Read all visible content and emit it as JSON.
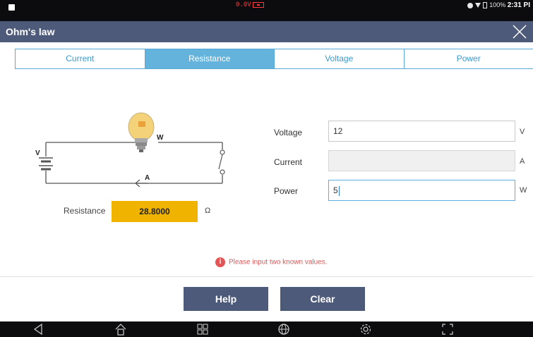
{
  "status_bar": {
    "battery_voltage": "0.0V",
    "battery_percent": "100%",
    "time": "2:31 PI"
  },
  "header": {
    "title": "Ohm's law"
  },
  "tabs": [
    {
      "label": "Current",
      "active": false
    },
    {
      "label": "Resistance",
      "active": true
    },
    {
      "label": "Voltage",
      "active": false
    },
    {
      "label": "Power",
      "active": false
    }
  ],
  "circuit": {
    "voltage_symbol": "V",
    "power_symbol": "W",
    "current_symbol": "A"
  },
  "result": {
    "label": "Resistance",
    "value": "28.8000",
    "unit": "Ω"
  },
  "fields": {
    "voltage": {
      "label": "Voltage",
      "value": "12",
      "unit": "V"
    },
    "current": {
      "label": "Current",
      "value": "",
      "unit": "A"
    },
    "power": {
      "label": "Power",
      "value": "5",
      "unit": "W"
    }
  },
  "message": "Please input two known values.",
  "buttons": {
    "help": "Help",
    "clear": "Clear"
  },
  "colors": {
    "header_bg": "#4e5a7a",
    "tab_active": "#63b3dd",
    "result_bg": "#f0b400",
    "error": "#e35555"
  }
}
